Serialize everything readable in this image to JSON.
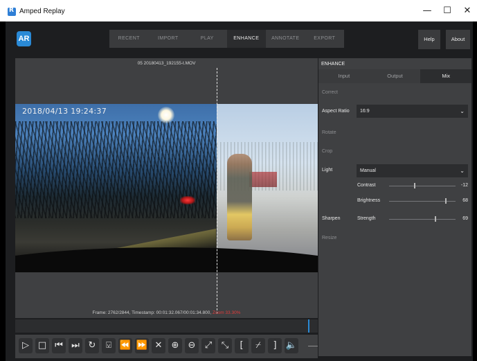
{
  "window": {
    "title": "Amped Replay",
    "minimize_glyph": "—",
    "maximize_glyph": "☐",
    "close_glyph": "✕"
  },
  "header": {
    "logo_text": "AR",
    "nav_tabs": [
      "RECENT",
      "IMPORT",
      "PLAY",
      "ENHANCE",
      "ANNOTATE",
      "EXPORT"
    ],
    "active_tab": "ENHANCE",
    "help_label": "Help",
    "about_label": "About"
  },
  "video": {
    "filename": "05 20180413_192155-t.MOV",
    "overlay_timestamp": "2018/04/13   19:24:37",
    "frame_info": "Frame: 2762/2844, Timestamp: 00:01:32.067/00:01:34.800,",
    "zoom_info": "Zoom 33.30%"
  },
  "timeline": {
    "position_fraction": 0.971
  },
  "transport": {
    "icons": [
      {
        "name": "play-icon",
        "glyph": "▷"
      },
      {
        "name": "stop-icon",
        "glyph": "□"
      },
      {
        "name": "skip-start-icon",
        "glyph": "⏮"
      },
      {
        "name": "next-frame-icon",
        "glyph": "⏭"
      },
      {
        "name": "loop-icon",
        "glyph": "↻"
      },
      {
        "name": "bookmark-icon",
        "glyph": "⍌"
      },
      {
        "name": "rewind-icon",
        "glyph": "⏪"
      },
      {
        "name": "fast-forward-icon",
        "glyph": "⏩"
      },
      {
        "name": "clear-icon",
        "glyph": "✕"
      },
      {
        "name": "zoom-in-icon",
        "glyph": "⊕"
      },
      {
        "name": "zoom-out-icon",
        "glyph": "⊖"
      },
      {
        "name": "fit-expand-icon",
        "glyph": "⤢"
      },
      {
        "name": "fit-shrink-icon",
        "glyph": "⤡"
      },
      {
        "name": "mark-in-icon",
        "glyph": "["
      },
      {
        "name": "clear-marks-icon",
        "glyph": "⌿"
      },
      {
        "name": "mark-out-icon",
        "glyph": "]"
      },
      {
        "name": "volume-icon",
        "glyph": "🔈"
      }
    ]
  },
  "enhance": {
    "title": "ENHANCE",
    "tabs": [
      "Input",
      "Output",
      "Mix"
    ],
    "active_tab": "Mix",
    "sections": {
      "correct": "Correct",
      "aspect_ratio_label": "Aspect Ratio",
      "aspect_ratio_value": "16:9",
      "rotate": "Rotate",
      "crop": "Crop",
      "light_label": "Light",
      "light_value": "Manual",
      "contrast_label": "Contrast",
      "contrast_value": "-12",
      "contrast_fraction": 0.37,
      "brightness_label": "Brightness",
      "brightness_value": "68",
      "brightness_fraction": 0.84,
      "sharpen_label": "Sharpen",
      "strength_label": "Strength",
      "strength_value": "69",
      "strength_fraction": 0.69,
      "resize": "Resize"
    },
    "chevron_glyph": "⌄"
  },
  "colors": {
    "accent": "#2a8ad6",
    "zoom_text": "#e23b3b"
  }
}
